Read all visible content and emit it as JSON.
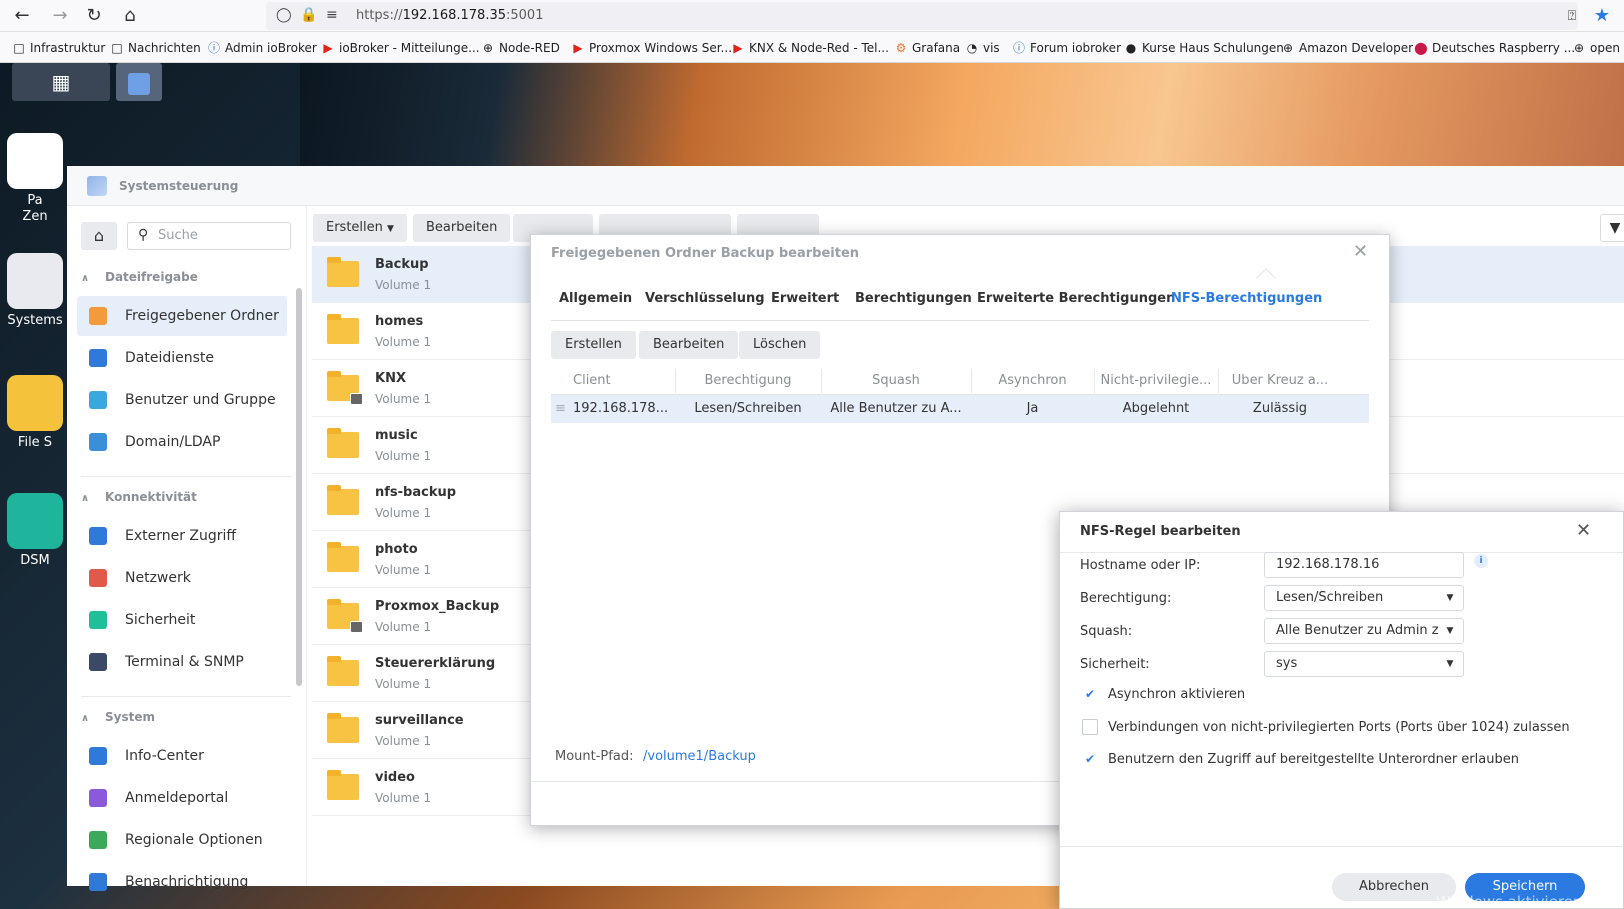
{
  "browser": {
    "url_prefix": "https://",
    "url_host": "192.168.178.35",
    "url_port": ":5001",
    "bookmarks": [
      {
        "label": "Infrastruktur",
        "icon": "folder-icon"
      },
      {
        "label": "Nachrichten",
        "icon": "folder-icon"
      },
      {
        "label": "Admin ioBroker",
        "icon": "iobroker-icon"
      },
      {
        "label": "ioBroker - Mitteilunge...",
        "icon": "youtube-icon"
      },
      {
        "label": "Node-RED",
        "icon": "globe-icon"
      },
      {
        "label": "Proxmox Windows Ser...",
        "icon": "youtube-icon"
      },
      {
        "label": "KNX & Node-Red - Tel...",
        "icon": "youtube-icon"
      },
      {
        "label": "Grafana",
        "icon": "grafana-icon"
      },
      {
        "label": "vis",
        "icon": "vis-icon"
      },
      {
        "label": "Forum iobroker",
        "icon": "iobroker-icon"
      },
      {
        "label": "Kurse Haus Schulungen",
        "icon": "dark-circle-icon"
      },
      {
        "label": "Amazon Developer",
        "icon": "globe-icon"
      },
      {
        "label": "Deutsches Raspberry ...",
        "icon": "raspberry-icon"
      },
      {
        "label": "open",
        "icon": "globe-icon"
      }
    ]
  },
  "desktop": {
    "icons": [
      {
        "label": "Pa\nZen",
        "color": "#ffffff"
      },
      {
        "label": "Systems",
        "color": "#e8eaf0"
      },
      {
        "label": "File S",
        "color": "#f5c33b"
      },
      {
        "label": "DSM",
        "color": "#1fb59d"
      }
    ],
    "watermark": "Windows aktivieren"
  },
  "window": {
    "title": "Systemsteuerung"
  },
  "sidebar": {
    "search_placeholder": "Suche",
    "sections": [
      {
        "title": "Dateifreigabe",
        "items": [
          {
            "label": "Freigegebener Ordner",
            "active": true,
            "color": "#f39a3a"
          },
          {
            "label": "Dateidienste",
            "color": "#2f7ad9"
          },
          {
            "label": "Benutzer und Gruppe",
            "color": "#3aa7e0"
          },
          {
            "label": "Domain/LDAP",
            "color": "#3a8fd9"
          }
        ]
      },
      {
        "title": "Konnektivität",
        "items": [
          {
            "label": "Externer Zugriff",
            "color": "#2f7ad9"
          },
          {
            "label": "Netzwerk",
            "color": "#e05a4a"
          },
          {
            "label": "Sicherheit",
            "color": "#1fbf9a"
          },
          {
            "label": "Terminal & SNMP",
            "color": "#3a4a66"
          }
        ]
      },
      {
        "title": "System",
        "items": [
          {
            "label": "Info-Center",
            "color": "#2f7ad9"
          },
          {
            "label": "Anmeldeportal",
            "color": "#8a5ad9"
          },
          {
            "label": "Regionale Optionen",
            "color": "#3aaa5a"
          },
          {
            "label": "Benachrichtigung",
            "color": "#2f7ad9"
          }
        ]
      }
    ]
  },
  "toolbar": {
    "create": "Erstellen",
    "edit": "Bearbeiten"
  },
  "folders": [
    {
      "name": "Backup",
      "volume": "Volume 1",
      "selected": true,
      "locked": false
    },
    {
      "name": "homes",
      "volume": "Volume 1",
      "locked": false
    },
    {
      "name": "KNX",
      "volume": "Volume 1",
      "locked": true
    },
    {
      "name": "music",
      "volume": "Volume 1",
      "locked": false
    },
    {
      "name": "nfs-backup",
      "volume": "Volume 1",
      "locked": false
    },
    {
      "name": "photo",
      "volume": "Volume 1",
      "locked": false
    },
    {
      "name": "Proxmox_Backup",
      "volume": "Volume 1",
      "locked": true
    },
    {
      "name": "Steuererklärung",
      "volume": "Volume 1",
      "locked": false
    },
    {
      "name": "surveillance",
      "volume": "Volume 1",
      "locked": false
    },
    {
      "name": "video",
      "volume": "Volume 1",
      "locked": false
    }
  ],
  "edit_dialog": {
    "title": "Freigegebenen Ordner Backup bearbeiten",
    "tabs": [
      "Allgemein",
      "Verschlüsselung",
      "Erweitert",
      "Berechtigungen",
      "Erweiterte Berechtigungen",
      "NFS-Berechtigungen"
    ],
    "active_tab": 5,
    "buttons": {
      "create": "Erstellen",
      "edit": "Bearbeiten",
      "delete": "Löschen"
    },
    "columns": [
      "Client",
      "Berechtigung",
      "Squash",
      "Asynchron",
      "Nicht-privilegie...",
      "Über Kreuz a..."
    ],
    "rows": [
      [
        "192.168.178...",
        "Lesen/Schreiben",
        "Alle Benutzer zu A...",
        "Ja",
        "Abgelehnt",
        "Zulässig"
      ]
    ],
    "mount_label": "Mount-Pfad:",
    "mount_path": "/volume1/Backup"
  },
  "nfs_dialog": {
    "title": "NFS-Regel bearbeiten",
    "hostname_label": "Hostname oder IP:",
    "hostname_value": "192.168.178.16",
    "permission_label": "Berechtigung:",
    "permission_value": "Lesen/Schreiben",
    "squash_label": "Squash:",
    "squash_value": "Alle Benutzer zu Admin z",
    "security_label": "Sicherheit:",
    "security_value": "sys",
    "checkboxes": [
      {
        "label": "Asynchron aktivieren",
        "checked": true
      },
      {
        "label": "Verbindungen von nicht-privilegierten Ports (Ports über 1024) zulassen",
        "checked": false
      },
      {
        "label": "Benutzern den Zugriff auf bereitgestellte Unterordner erlauben",
        "checked": true
      }
    ],
    "cancel": "Abbrechen",
    "save": "Speichern"
  }
}
